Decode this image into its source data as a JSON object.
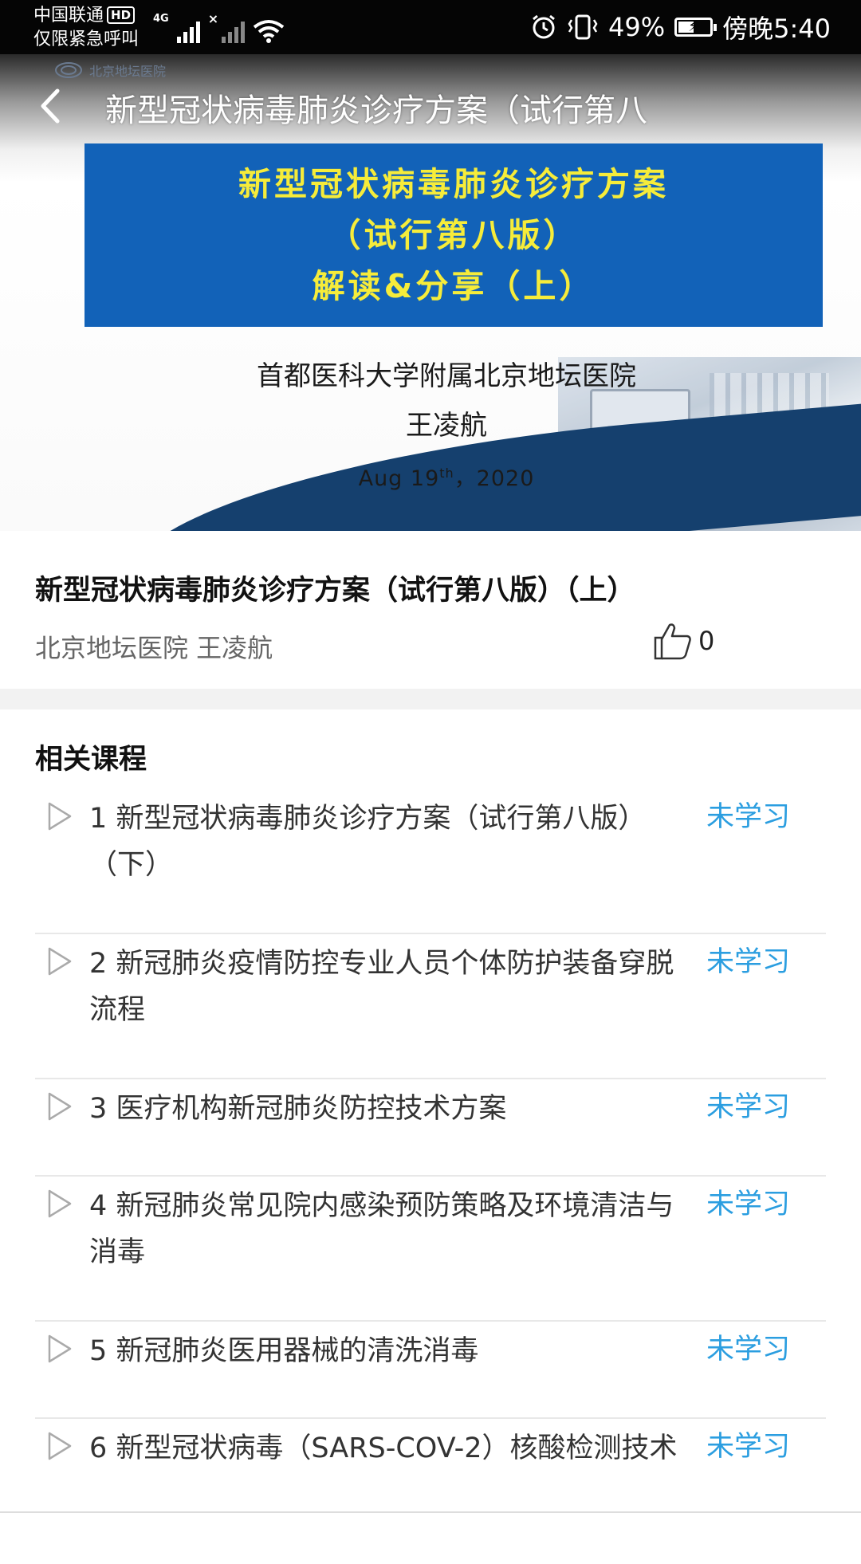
{
  "status_bar": {
    "carrier": "中国联通",
    "hd": "HD",
    "emergency": "仅限紧急呼叫",
    "network": "4G",
    "battery": "49%",
    "battery_level": 0.49,
    "time": "傍晚5:40"
  },
  "hero": {
    "logo_text": "北京地坛医院",
    "nav_title": "新型冠状病毒肺炎诊疗方案（试行第八",
    "banner_lines": [
      "新型冠状病毒肺炎诊疗方案",
      "（试行第八版）",
      "解读&分享（上）"
    ],
    "institution": "首都医科大学附属北京地坛医院",
    "speaker": "王凌航",
    "date_main": "Aug 19",
    "date_sup": "th",
    "date_year": "，2020"
  },
  "course": {
    "title": "新型冠状病毒肺炎诊疗方案（试行第八版）（上）",
    "author": "北京地坛医院 王凌航",
    "likes": "0"
  },
  "related": {
    "heading": "相关课程",
    "items": [
      {
        "text": "1 新型冠状病毒肺炎诊疗方案（试行第八版）（下）",
        "status": "未学习"
      },
      {
        "text": "2 新冠肺炎疫情防控专业人员个体防护装备穿脱流程",
        "status": "未学习"
      },
      {
        "text": "3 医疗机构新冠肺炎防控技术方案",
        "status": "未学习"
      },
      {
        "text": "4 新冠肺炎常见院内感染预防策略及环境清洁与消毒",
        "status": "未学习"
      },
      {
        "text": "5 新冠肺炎医用器械的清洗消毒",
        "status": "未学习"
      },
      {
        "text": "6 新型冠状病毒（SARS-COV-2）核酸检测技术",
        "status": "未学习"
      }
    ]
  },
  "colors": {
    "banner_blue": "#1262b8",
    "banner_text_yellow": "#f6ec3a",
    "status_link_blue": "#2b9ee0"
  }
}
